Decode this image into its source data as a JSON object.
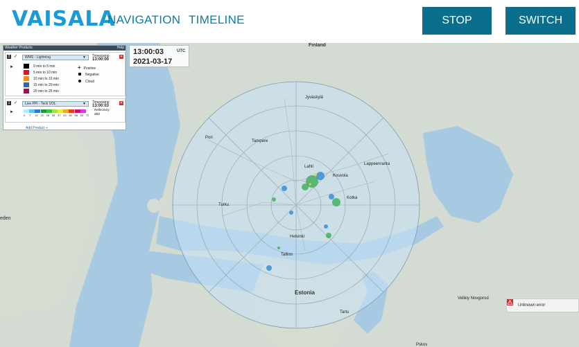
{
  "header": {
    "logo": "VAISALA",
    "nav": {
      "navigation": "NAVIGATION",
      "timeline": "TIMELINE"
    },
    "buttons": {
      "stop": "STOP",
      "switch": "SWITCH"
    }
  },
  "products_panel": {
    "title": "Weather Products",
    "help": "Help",
    "add_product": "Add Product +",
    "layers": [
      {
        "index": "2",
        "product": "WMS - Lightning",
        "timestamp_label": "Timestamp",
        "timestamp": "13:00:00",
        "legend": [
          {
            "label": "0 min to 5 min",
            "color": "#000000"
          },
          {
            "label": "5 min to 10 min",
            "color": "#e8141c"
          },
          {
            "label": "10 min to 15 min",
            "color": "#f08c1c"
          },
          {
            "label": "15 min to 20 min",
            "color": "#2a6ab4"
          },
          {
            "label": "20 min to 25 min",
            "color": "#8c1a4c"
          }
        ],
        "symbols": [
          {
            "label": "Positive",
            "icon": "plus-icon"
          },
          {
            "label": "Negative",
            "icon": "square-icon"
          },
          {
            "label": "Cloud",
            "icon": "dot-icon"
          }
        ]
      },
      {
        "index": "1",
        "product": "Live PPI - Teck VOL",
        "timestamp_label": "Timestamp",
        "timestamp": "13:00:03",
        "unit_label": "Reflectivity",
        "unit": "dBZ",
        "scale_ticks": [
          "2",
          "7",
          "12",
          "21",
          "28",
          "33",
          "37",
          "43",
          "52",
          "58",
          "63",
          "72"
        ],
        "scale_colors": [
          "#a8f0ff",
          "#5bc4f0",
          "#2a7bd8",
          "#1c9c3c",
          "#38c838",
          "#a8e048",
          "#f0e838",
          "#f0a828",
          "#e83c1c",
          "#c0147c",
          "#e038e0",
          "#ffffff"
        ]
      }
    ]
  },
  "time_display": {
    "time": "13:00:03",
    "utc": "UTC",
    "date": "2021-03-17"
  },
  "map": {
    "place_labels": {
      "finland": "Finland",
      "estonia": "Estonia",
      "helsinki": "Helsinki",
      "tallinn": "Tallinn",
      "tartu": "Tartu",
      "pori": "Pori",
      "tampere": "Tampere",
      "turku": "Turku",
      "lahti": "Lahti",
      "jyvaskyla": "Jyväskylä",
      "kouvola": "Kouvola",
      "lappeenranta": "Lappeenranta",
      "kotka": "Kotka",
      "pskov": "Pskov",
      "velikiy_novgorod": "Velikiy Novgorod",
      "sweden_fragment": "eden"
    },
    "error_message": "Unknown error"
  }
}
